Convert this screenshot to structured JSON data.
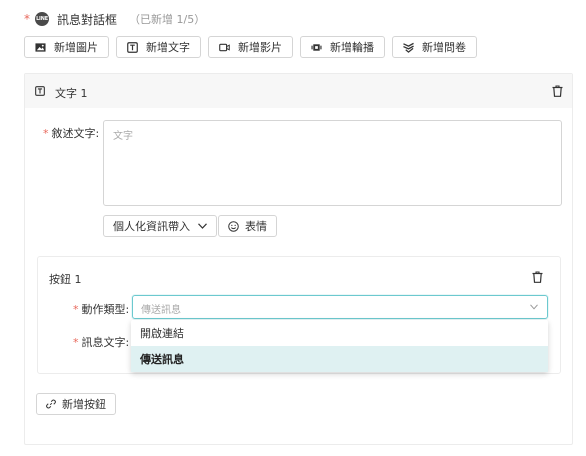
{
  "header": {
    "required_mark": "*",
    "line_badge": "LINE",
    "title": "訊息對話框",
    "count": "（已新增 1/5）"
  },
  "toolbar": {
    "add_image": "新增圖片",
    "add_text": "新增文字",
    "add_video": "新增影片",
    "add_carousel": "新增輪播",
    "add_survey": "新增問卷"
  },
  "text_block": {
    "title": "文字 1",
    "description_label": "敘述文字:",
    "description_placeholder": "文字",
    "personalize_label": "個人化資訊帶入",
    "emoji_label": "表情"
  },
  "button_block": {
    "title": "按鈕 1",
    "action_type_label": "動作類型:",
    "action_type_placeholder": "傳送訊息",
    "message_text_label": "訊息文字:",
    "options": [
      "開啟連結",
      "傳送訊息"
    ],
    "selected_option": "傳送訊息"
  },
  "add_button_label": "新增按鈕",
  "colors": {
    "required": "#e8685b",
    "focus_border": "#6cc9cf",
    "selected_option_bg": "#dff1f2"
  }
}
